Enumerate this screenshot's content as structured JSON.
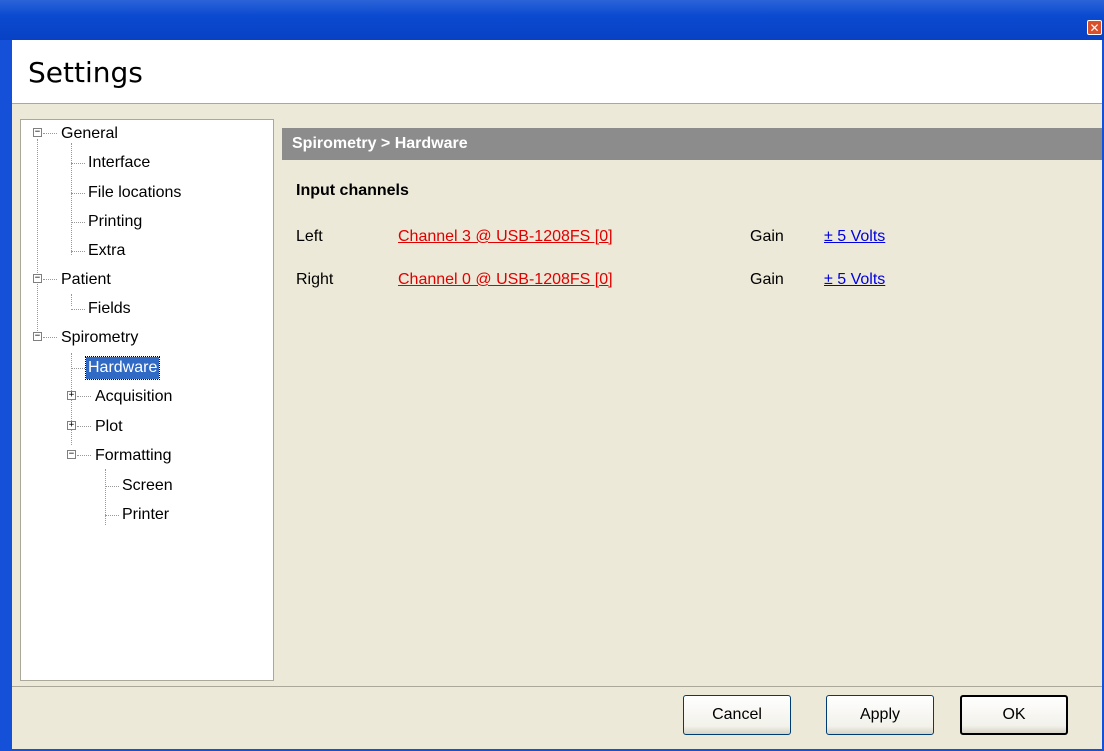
{
  "window": {
    "title": "Settings",
    "close_icon": "close-icon"
  },
  "tree": {
    "items": [
      {
        "label": "General",
        "expanded": true
      },
      {
        "label": "Interface"
      },
      {
        "label": "File locations"
      },
      {
        "label": "Printing"
      },
      {
        "label": "Extra"
      },
      {
        "label": "Patient",
        "expanded": true
      },
      {
        "label": "Fields"
      },
      {
        "label": "Spirometry",
        "expanded": true
      },
      {
        "label": "Hardware",
        "selected": true
      },
      {
        "label": "Acquisition",
        "expanded": false
      },
      {
        "label": "Plot",
        "expanded": false
      },
      {
        "label": "Formatting",
        "expanded": true
      },
      {
        "label": "Screen"
      },
      {
        "label": "Printer"
      }
    ]
  },
  "content": {
    "breadcrumb": "Spirometry > Hardware",
    "section_title": "Input channels",
    "channels": [
      {
        "side": "Left",
        "channel": "Channel 3 @ USB-1208FS [0]",
        "gain_label": "Gain",
        "gain": "± 5 Volts"
      },
      {
        "side": "Right",
        "channel": "Channel 0 @ USB-1208FS [0]",
        "gain_label": "Gain",
        "gain": "± 5 Volts"
      }
    ]
  },
  "buttons": {
    "cancel": "Cancel",
    "apply": "Apply",
    "ok": "OK"
  },
  "colors": {
    "title_bar": "#0A4AD0",
    "selection": "#316AC5",
    "channel_link": "#E00000",
    "gain_link": "#0000E0",
    "band": "#8C8C8C"
  }
}
